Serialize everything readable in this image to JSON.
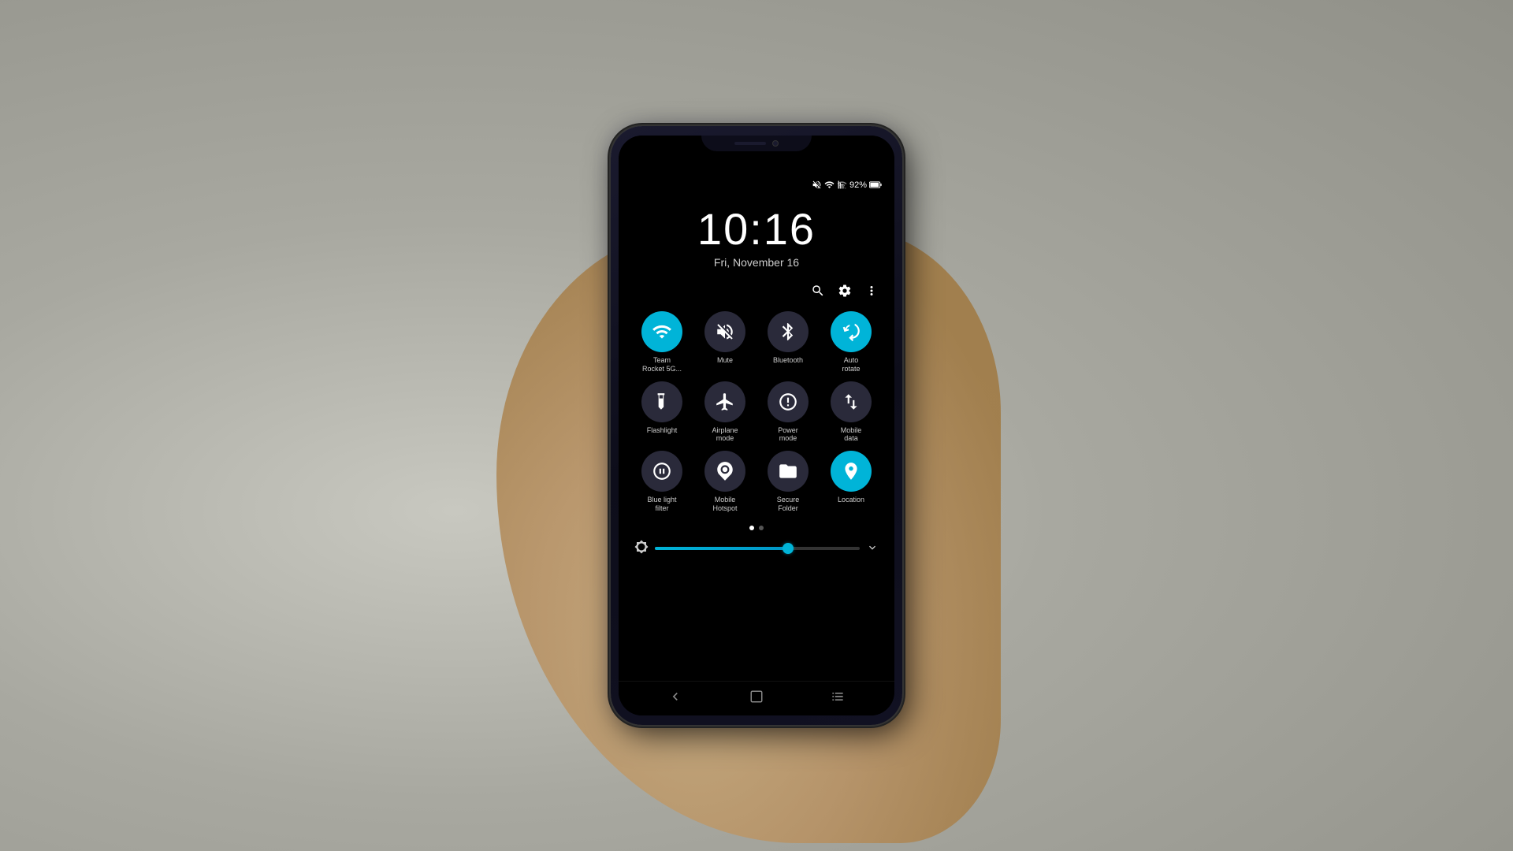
{
  "background_color": "#b0a898",
  "phone": {
    "time": "10:16",
    "date": "Fri, November 16",
    "battery": "92%",
    "status_icons": [
      "mute",
      "wifi",
      "signal",
      "battery"
    ]
  },
  "quick_settings": {
    "search_label": "🔍",
    "settings_label": "⚙",
    "more_label": "⋮",
    "tiles": [
      {
        "id": "wifi",
        "label": "Team\nRocket 5G...",
        "active": true
      },
      {
        "id": "mute",
        "label": "Mute",
        "active": false
      },
      {
        "id": "bluetooth",
        "label": "Bluetooth",
        "active": false
      },
      {
        "id": "auto-rotate",
        "label": "Auto\nrotate",
        "active": true
      },
      {
        "id": "flashlight",
        "label": "Flashlight",
        "active": false
      },
      {
        "id": "airplane",
        "label": "Airplane\nmode",
        "active": false
      },
      {
        "id": "power-mode",
        "label": "Power\nmode",
        "active": false
      },
      {
        "id": "mobile-data",
        "label": "Mobile\ndata",
        "active": false
      },
      {
        "id": "blue-light",
        "label": "Blue light\nfilter",
        "active": false
      },
      {
        "id": "mobile-hotspot",
        "label": "Mobile\nHotspot",
        "active": false
      },
      {
        "id": "secure-folder",
        "label": "Secure\nFolder",
        "active": false
      },
      {
        "id": "location",
        "label": "Location",
        "active": true
      }
    ],
    "brightness_percent": 65,
    "page_dots": [
      {
        "active": true
      },
      {
        "active": false
      }
    ]
  },
  "nav_bar": {
    "back_label": "‹",
    "home_label": "□",
    "recents_label": "⫶"
  }
}
